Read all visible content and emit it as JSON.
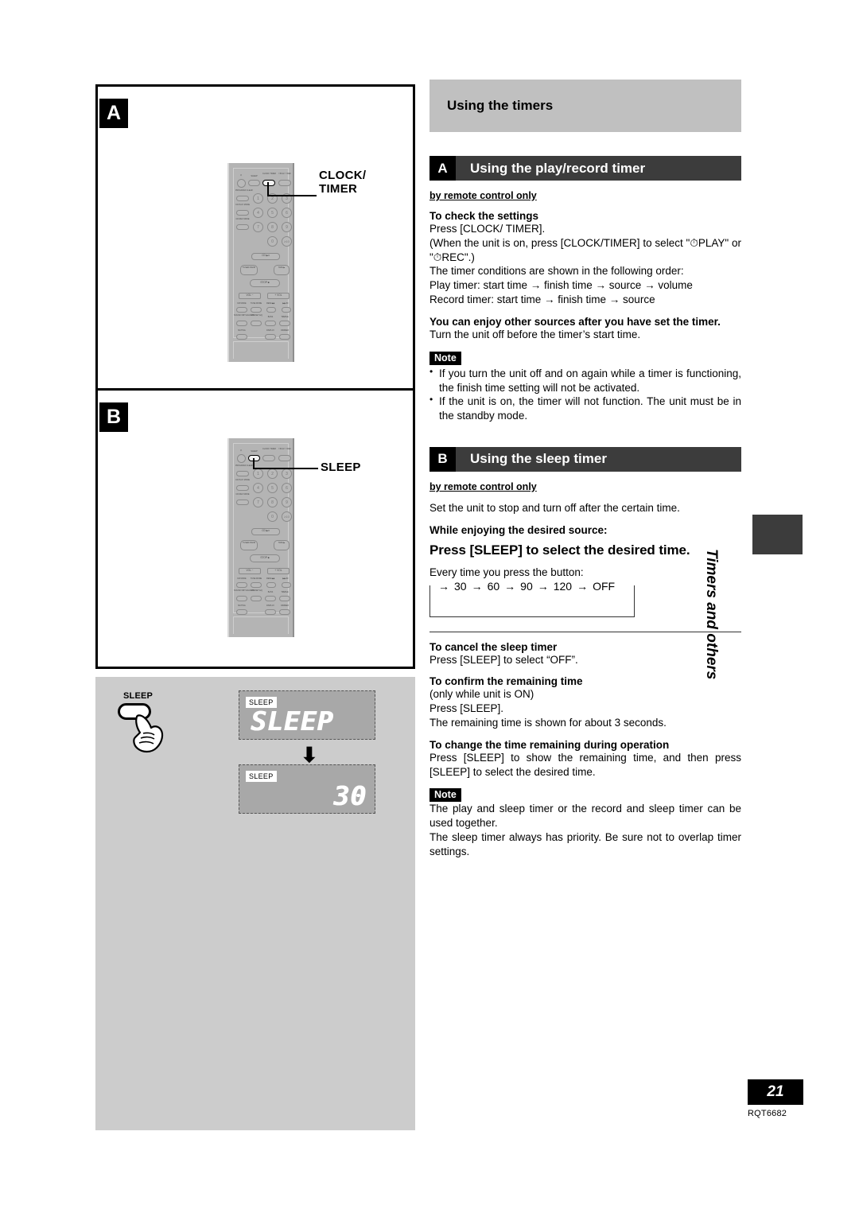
{
  "section": {
    "title": "Using the timers"
  },
  "sub_a": {
    "letter": "A",
    "title": "Using the play/record timer",
    "remote_only": "by remote control only",
    "check_head": "To check the settings",
    "check_lines": [
      "Press [CLOCK/ TIMER].",
      "(When the unit is on, press [CLOCK/TIMER] to select \"⏱PLAY\" or \"⏱REC\".)",
      "The timer conditions are shown in the following order:",
      "Play timer: start time → finish time → source → volume",
      "Record timer: start time → finish time → source"
    ],
    "enjoy_head": "You can enjoy other sources after you have set the timer.",
    "enjoy_body": "Turn the unit off before the timer’s start time.",
    "note_label": "Note",
    "notes": [
      "If you turn the unit off and on again while a timer is functioning, the finish time setting will not be activated.",
      "If the unit is on, the timer will not function. The unit must be in the standby mode."
    ]
  },
  "sub_b": {
    "letter": "B",
    "title": "Using the sleep timer",
    "remote_only": "by remote control only",
    "intro": "Set the unit to stop and turn off after the certain time.",
    "while_head": "While enjoying the desired source:",
    "step": "Press [SLEEP] to select the desired time.",
    "every_time": "Every time you press the button:",
    "cycle": [
      "30",
      "60",
      "90",
      "120",
      "OFF"
    ],
    "cancel_head": "To cancel the sleep timer",
    "cancel_body": "Press [SLEEP] to select “OFF”.",
    "confirm_head": "To confirm the remaining time",
    "confirm_lines": [
      "(only while unit is ON)",
      "Press [SLEEP].",
      "The remaining time is shown for about 3 seconds."
    ],
    "change_head": "To change the time remaining during operation",
    "change_body": "Press [SLEEP] to show the remaining time, and then press [SLEEP] to select the desired time.",
    "note_label": "Note",
    "note_lines": [
      "The play and sleep timer or the record and sleep timer can be used together.",
      "The sleep timer always has priority. Be sure not to overlap timer settings."
    ]
  },
  "figures": {
    "badge_a": "A",
    "badge_b": "B",
    "callout_a_line1": "CLOCK/",
    "callout_a_line2": "TIMER",
    "callout_b": "SLEEP"
  },
  "remote": {
    "top_row": [
      "⏻",
      "SLEEP",
      "CLOCK/ TIMER",
      "⏱PLAY/ ⏱REC"
    ],
    "left_col": [
      "PROGRAM/ CLEAR",
      "CD PLAY MODE",
      "CD REC MODE"
    ],
    "numbers": [
      "1",
      "2",
      "3",
      "4",
      "5",
      "6",
      "7",
      "8",
      "9",
      "0",
      "≥10"
    ],
    "transport": [
      "CD ▶Ⅱ",
      "TUNER/ BAND",
      "TAPE ▶",
      "STOP ■"
    ],
    "volume": [
      "VOL −",
      "+ VOL"
    ],
    "row_fm": [
      "FM MODE",
      "TUNE MODE",
      "REW/◀◀",
      "▶▶/FF"
    ],
    "row_sound": [
      "SOUND VIRTUALIZER",
      "PRESET EQ",
      "BASS",
      "TREBLE"
    ],
    "row_last": [
      "MUTING",
      "DISPLAY",
      "DIMMER"
    ]
  },
  "display_panel": {
    "button_label": "SLEEP",
    "lcd1_tag": "SLEEP",
    "lcd1_value": "SLEEP",
    "lcd2_tag": "SLEEP",
    "lcd2_value": "30"
  },
  "sidebar": {
    "vertical_label": "Timers and others"
  },
  "footer": {
    "page_number": "21",
    "doc_code": "RQT6682"
  }
}
